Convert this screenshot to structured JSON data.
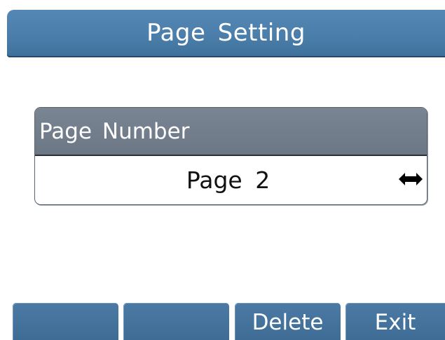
{
  "header": {
    "title": "Page  Setting"
  },
  "field": {
    "label": "Page  Number",
    "value": "Page  2",
    "switch_icon": "left-right-arrow-icon"
  },
  "softkeys": [
    {
      "label": ""
    },
    {
      "label": ""
    },
    {
      "label": "Delete"
    },
    {
      "label": "Exit"
    }
  ],
  "colors": {
    "title_bar": "#4b7eaa",
    "field_label_bg": "#6c7785",
    "softkey_bg": "#3e6c95",
    "background": "#ffffff"
  }
}
